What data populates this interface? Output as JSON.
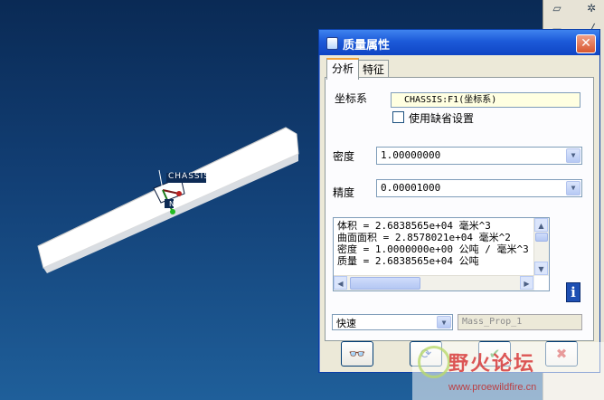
{
  "colors": {
    "background_top": "#0a2a55",
    "background_bottom": "#1f5f9a",
    "titlebar": "#1c5ad9",
    "dialog_face": "#ece9d8",
    "highlight_box": "#ffffe1"
  },
  "viewport": {
    "model_label": "CHASSIS"
  },
  "dialog": {
    "title": "质量属性",
    "close_glyph": "✕",
    "tabs": [
      {
        "label": "分析",
        "active": true
      },
      {
        "label": "特征",
        "active": false
      }
    ],
    "coordinate_system": {
      "label": "坐标系",
      "value": "CHASSIS:F1(坐标系)",
      "use_default_label": "使用缺省设置",
      "use_default_checked": false
    },
    "density": {
      "label": "密度",
      "value": "1.00000000"
    },
    "precision": {
      "label": "精度",
      "value": "0.00001000"
    },
    "results": [
      "体积 =  2.6838565e+04  毫米^3",
      "曲面面积 =  2.8578021e+04  毫米^2",
      "密度 =  1.0000000e+00 公吨 / 毫米^3",
      "质量 =  2.6838565e+04 公吨"
    ],
    "info_glyph": "i",
    "mode": {
      "value": "快速"
    },
    "analysis_name": {
      "placeholder": "Mass_Prop_1"
    },
    "buttons": {
      "glasses_glyph": "👓",
      "repeat_glyph": "⟳",
      "ok_glyph": "✔",
      "cancel_glyph": "✖"
    }
  },
  "watermark": {
    "text": "野火论坛",
    "url": "www.proewildfire.cn"
  }
}
